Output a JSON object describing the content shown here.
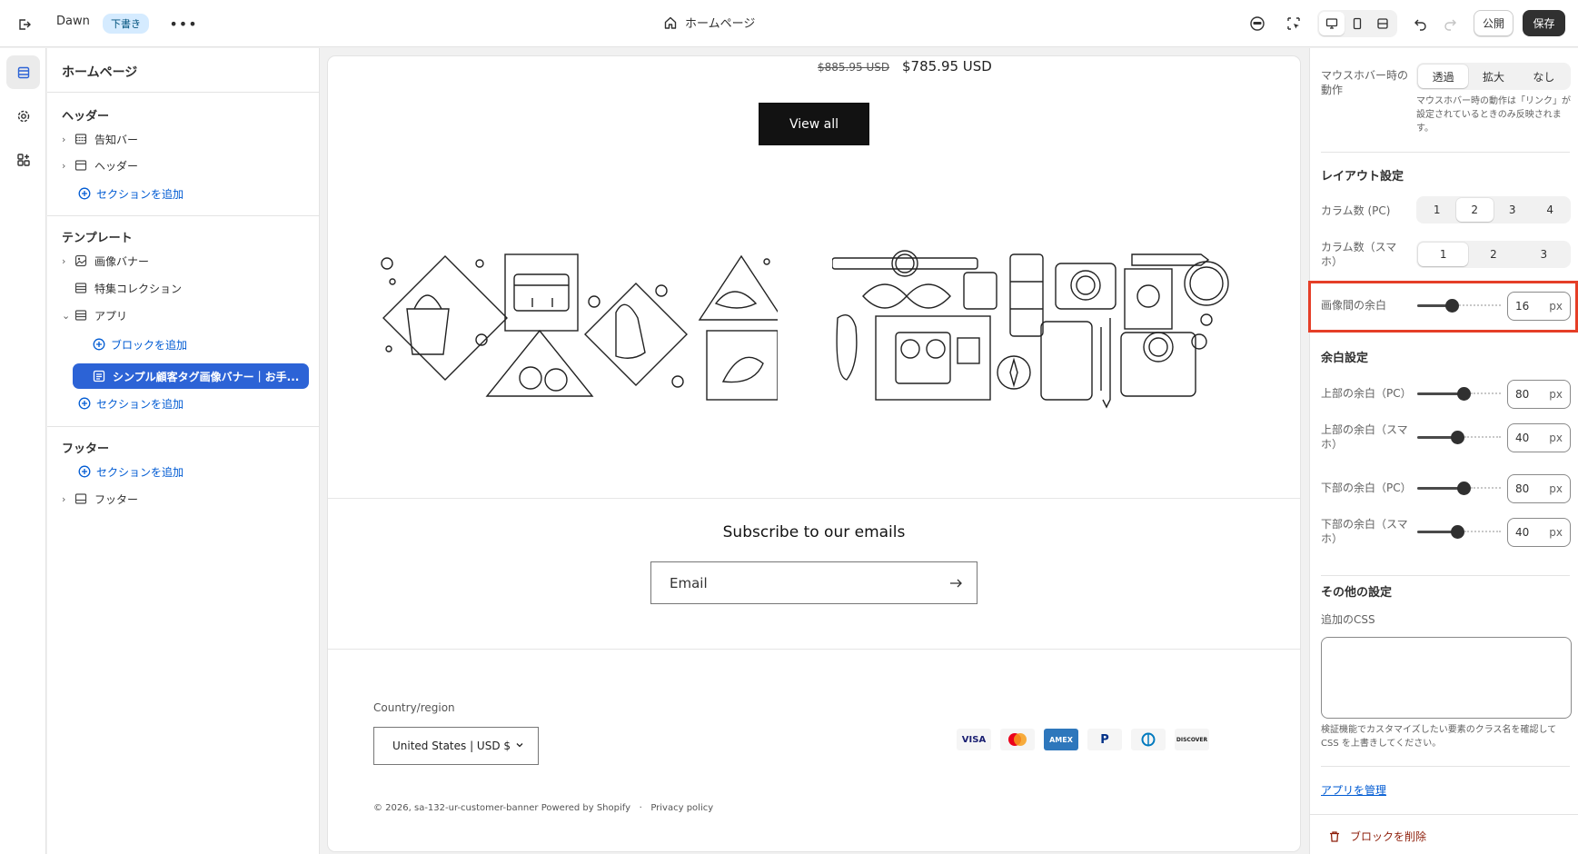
{
  "topbar": {
    "theme_name": "Dawn",
    "draft_badge": "下書き",
    "more_label": "•••",
    "page_title": "ホームページ",
    "publish_label": "公開",
    "save_label": "保存"
  },
  "sidebar": {
    "title": "ホームページ",
    "header_group": {
      "label": "ヘッダー",
      "items": [
        {
          "label": "告知バー",
          "icon": "announcement-icon"
        },
        {
          "label": "ヘッダー",
          "icon": "header-icon"
        }
      ],
      "add_section": "セクションを追加"
    },
    "template_group": {
      "label": "テンプレート",
      "items": [
        {
          "label": "画像バナー",
          "icon": "image-icon"
        },
        {
          "label": "特集コレクション",
          "icon": "collection-icon"
        },
        {
          "label": "アプリ",
          "icon": "app-icon"
        }
      ],
      "add_block": "ブロックを追加",
      "selected_block": "シンプル顧客タグ画像バナー｜お手...",
      "add_section": "セクションを追加"
    },
    "footer_group": {
      "label": "フッター",
      "add_section": "セクションを追加",
      "items": [
        {
          "label": "フッター",
          "icon": "footer-icon"
        }
      ]
    }
  },
  "preview": {
    "price_old": "$885.95 USD",
    "price_new": "$785.95 USD",
    "view_all": "View all",
    "subscribe_title": "Subscribe to our emails",
    "email_placeholder": "Email",
    "country_label": "Country/region",
    "country_value": "United States | USD $",
    "payment_methods": [
      "VISA",
      "Mastercard",
      "AMEX",
      "PayPal",
      "Diners",
      "DISCOVER"
    ],
    "copyright": "© 2026, sa-132-ur-customer-banner Powered by Shopify",
    "privacy": "Privacy policy"
  },
  "settings": {
    "hover_label": "マウスホバー時の動作",
    "hover_options": [
      "透過",
      "拡大",
      "なし"
    ],
    "hover_selected": "透過",
    "hover_help": "マウスホバー時の動作は「リンク」が設定されているときのみ反映されます。",
    "layout_heading": "レイアウト設定",
    "cols_pc_label": "カラム数 (PC)",
    "cols_pc_options": [
      "1",
      "2",
      "3",
      "4"
    ],
    "cols_pc_selected": "2",
    "cols_sp_label": "カラム数（スマホ）",
    "cols_sp_options": [
      "1",
      "2",
      "3"
    ],
    "cols_sp_selected": "1",
    "image_gap_label": "画像間の余白",
    "image_gap_value": "16",
    "unit": "px",
    "spacing_heading": "余白設定",
    "top_pc_label": "上部の余白（PC）",
    "top_pc_value": "80",
    "top_sp_label": "上部の余白（スマホ）",
    "top_sp_value": "40",
    "bottom_pc_label": "下部の余白（PC）",
    "bottom_pc_value": "80",
    "bottom_sp_label": "下部の余白（スマホ）",
    "bottom_sp_value": "40",
    "other_heading": "その他の設定",
    "css_label": "追加のCSS",
    "css_help": "検証機能でカスタマイズしたい要素のクラス名を確認して CSS を上書きしてください。",
    "manage_apps": "アプリを管理",
    "delete_block": "ブロックを削除"
  },
  "sliders": {
    "image_gap_fraction": 0.4,
    "top_pc_fraction": 0.57,
    "top_sp_fraction": 0.48,
    "bottom_pc_fraction": 0.57,
    "bottom_sp_fraction": 0.48
  },
  "colors": {
    "accent_blue": "#2c63d6",
    "link_blue": "#005bd3",
    "highlight_red": "#e53e27",
    "save_button": "#303030",
    "delete_red": "#8e1f0b"
  }
}
